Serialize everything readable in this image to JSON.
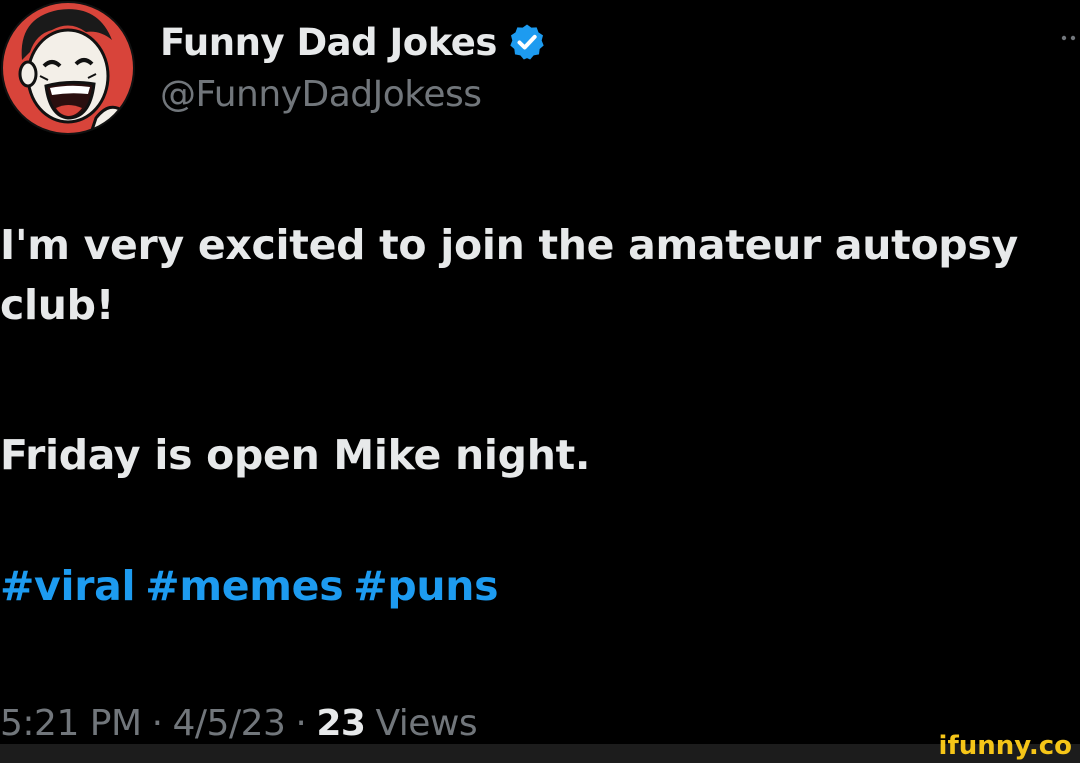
{
  "author": {
    "display_name": "Funny Dad Jokes",
    "handle": "@FunnyDadJokess",
    "verified": true,
    "avatar_icon": "laughing-face-avatar-icon"
  },
  "tweet": {
    "lines": [
      "I'm very excited to join the amateur autopsy",
      "club!",
      "Friday is open Mike night."
    ],
    "hashtags": [
      "#viral",
      "#memes",
      "#puns"
    ]
  },
  "meta": {
    "time": "5:21 PM",
    "separator": "·",
    "date": "4/5/23",
    "views_count": "23",
    "views_label": "Views"
  },
  "watermark": "ifunny.co",
  "colors": {
    "background": "#000000",
    "text_primary": "#e7e9ea",
    "text_secondary": "#71767b",
    "accent": "#1d9bf0",
    "watermark": "#f5c518"
  }
}
